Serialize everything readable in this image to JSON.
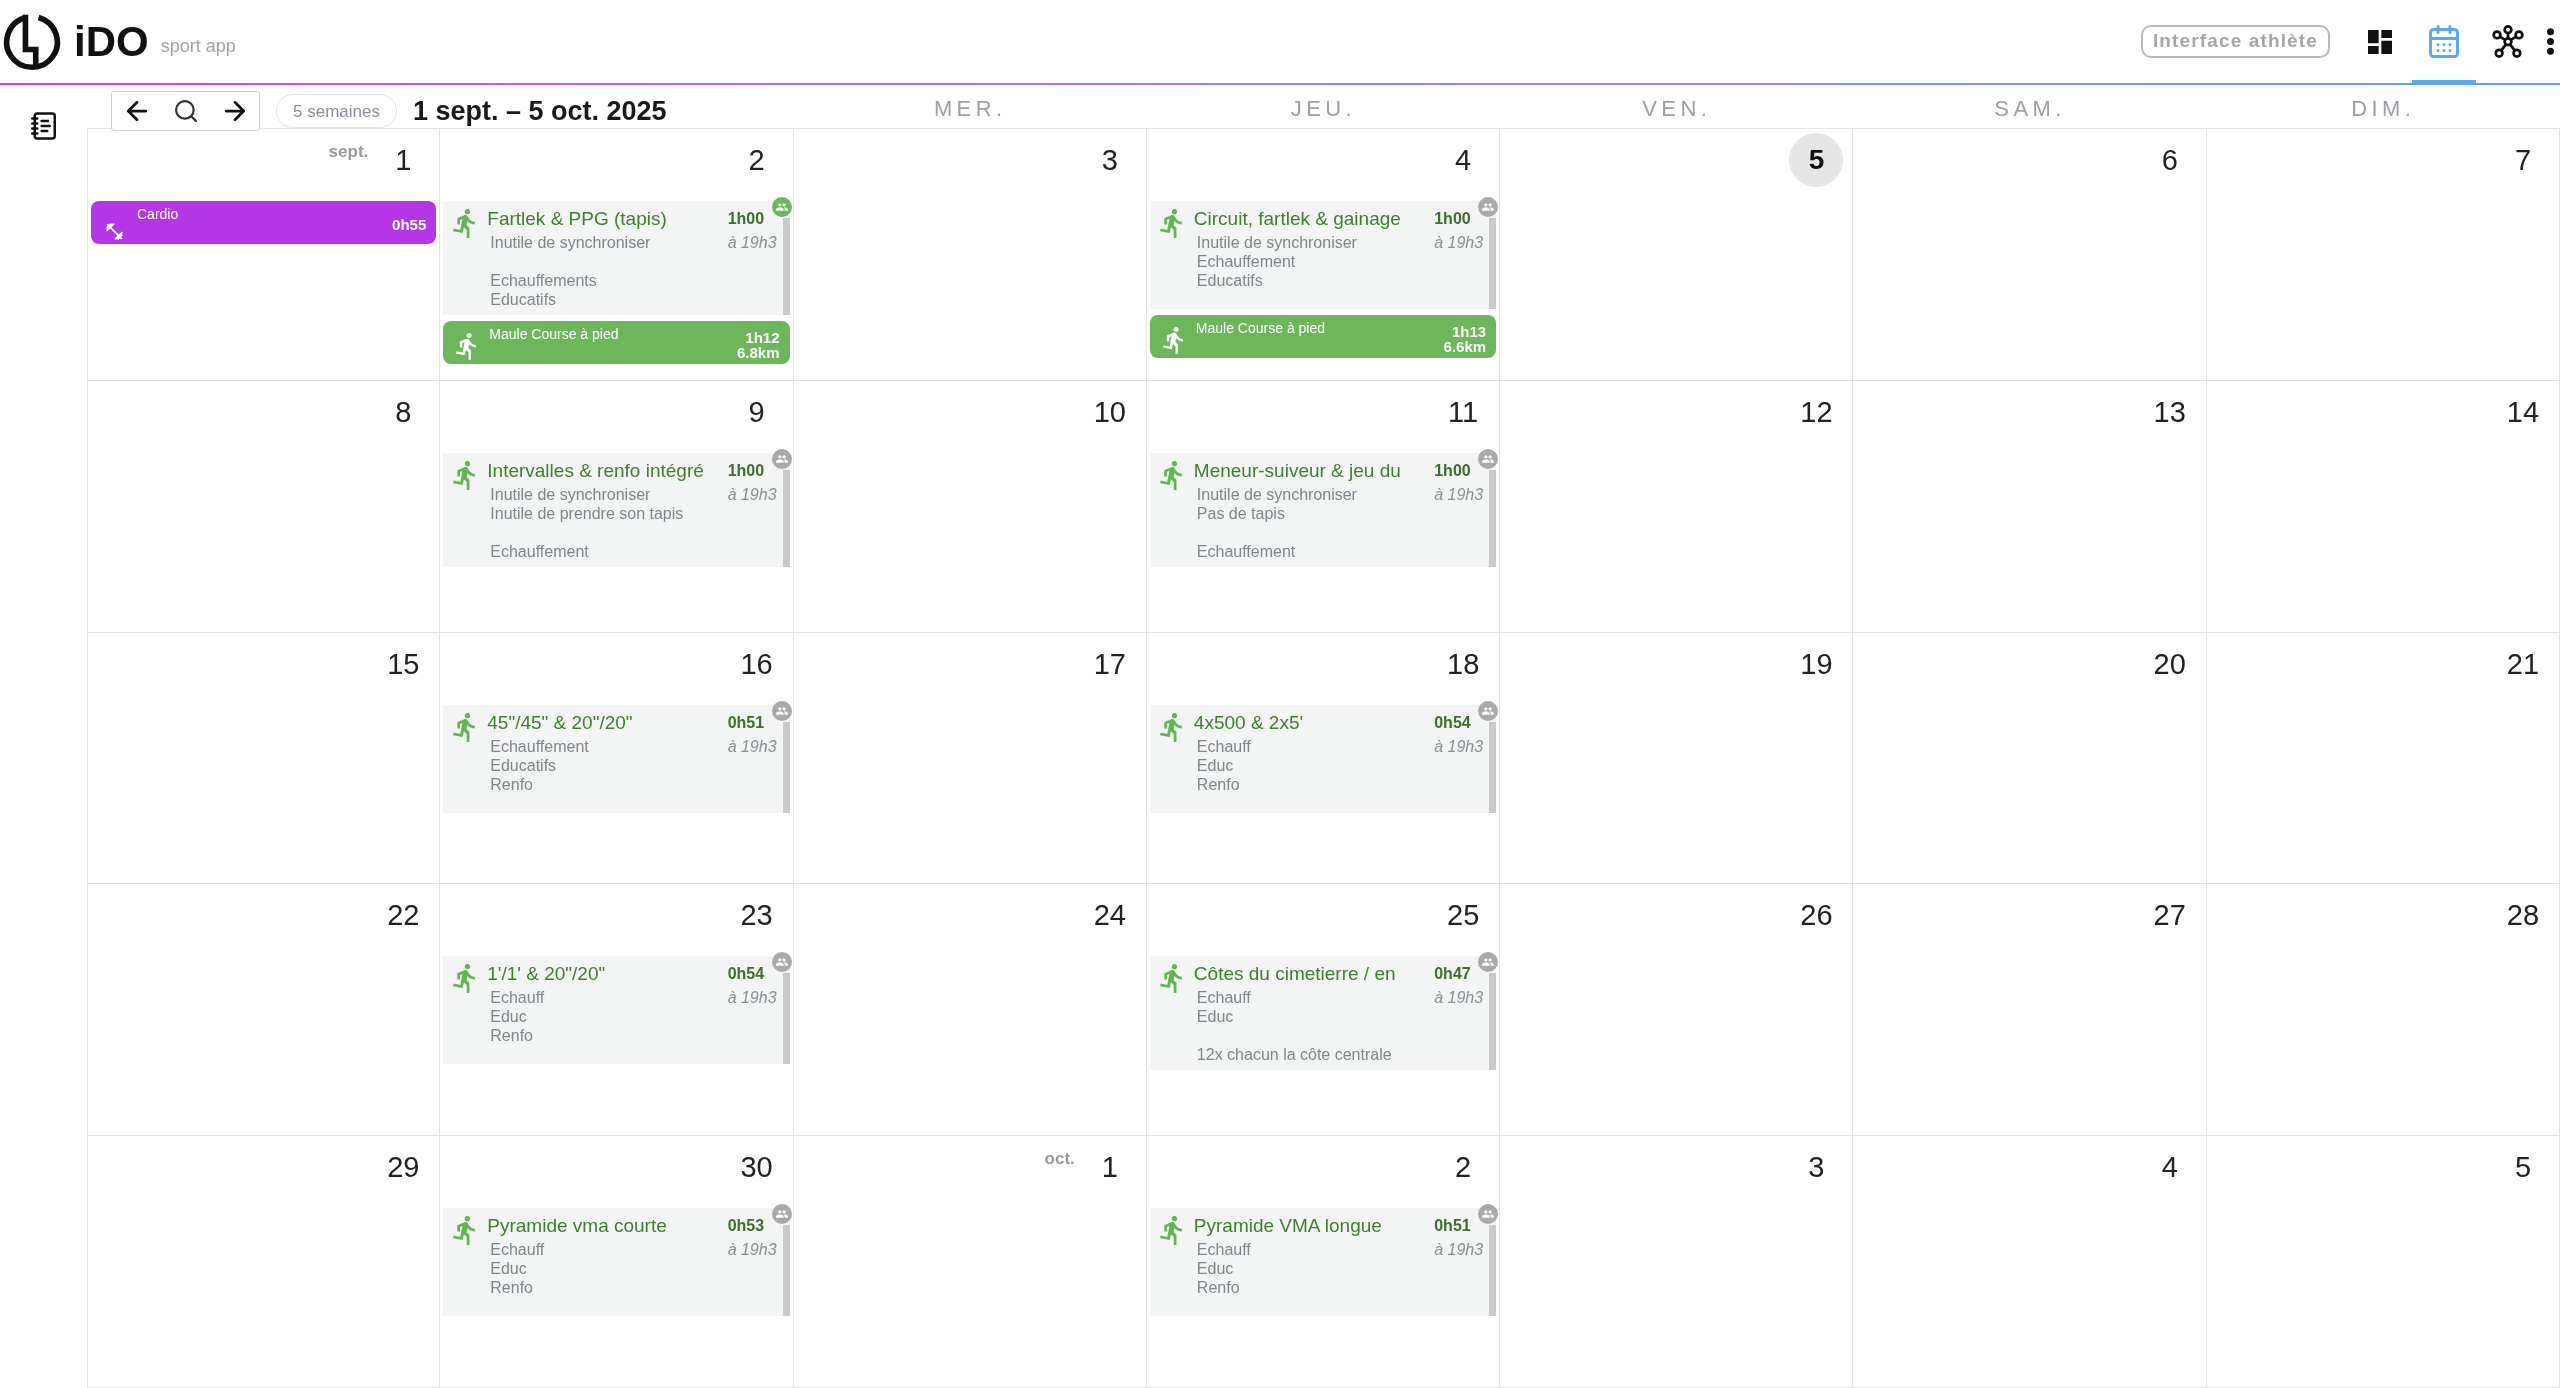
{
  "header": {
    "app_name": "iDO",
    "tagline": "sport app",
    "athlete_button": "Interface athlète",
    "nav": [
      {
        "kind": "dashboard",
        "selected": false
      },
      {
        "kind": "calendar",
        "selected": true
      },
      {
        "kind": "network",
        "selected": false
      },
      {
        "kind": "more",
        "selected": false
      }
    ]
  },
  "toolbar": {
    "range": "5 semaines",
    "title": "1 sept. – 5 oct. 2025"
  },
  "day_headers": [
    "MER.",
    "JEU.",
    "VEN.",
    "SAM.",
    "DIM."
  ],
  "weeks": [
    {
      "days": [
        {
          "number": "1",
          "month": "sept.",
          "today": false,
          "events": [
            {
              "kind": "strength",
              "title": "Cardio",
              "duration": "0h55"
            }
          ]
        },
        {
          "number": "2",
          "today": false,
          "events": [
            {
              "kind": "workout",
              "title": "Fartlek & PPG (tapis)",
              "duration": "1h00",
              "time": "à 19h3",
              "badge_active": true,
              "notes": [
                [
                  "Inutile de synchroniser"
                ],
                [
                  "Echauffements",
                  "Educatifs"
                ]
              ]
            },
            {
              "kind": "run",
              "title": "Maule Course à pied",
              "duration": "1h12",
              "distance": "6.8km"
            }
          ]
        },
        {
          "number": "3",
          "today": false
        },
        {
          "number": "4",
          "today": false,
          "events": [
            {
              "kind": "workout",
              "title": "Circuit, fartlek & gainage",
              "duration": "1h00",
              "time": "à 19h3",
              "badge_active": false,
              "notes": [
                [
                  "Inutile de synchroniser",
                  "Echauffement",
                  "Educatifs"
                ]
              ]
            },
            {
              "kind": "run",
              "title": "Maule Course à pied",
              "duration": "1h13",
              "distance": "6.6km"
            }
          ]
        },
        {
          "number": "5",
          "today": true
        },
        {
          "number": "6",
          "today": false
        },
        {
          "number": "7",
          "today": false
        }
      ]
    },
    {
      "days": [
        {
          "number": "8",
          "today": false
        },
        {
          "number": "9",
          "today": false,
          "events": [
            {
              "kind": "workout",
              "title": "Intervalles & renfo intégré",
              "duration": "1h00",
              "time": "à 19h3",
              "badge_active": false,
              "notes": [
                [
                  "Inutile de synchroniser",
                  "Inutile de prendre son tapis"
                ],
                [
                  "Echauffement"
                ]
              ]
            }
          ]
        },
        {
          "number": "10",
          "today": false
        },
        {
          "number": "11",
          "today": false,
          "events": [
            {
              "kind": "workout",
              "title": "Meneur-suiveur & jeu du",
              "duration": "1h00",
              "time": "à 19h3",
              "badge_active": false,
              "notes": [
                [
                  "Inutile de synchroniser",
                  "Pas de tapis"
                ],
                [
                  "Echauffement"
                ]
              ]
            }
          ]
        },
        {
          "number": "12",
          "today": false
        },
        {
          "number": "13",
          "today": false
        },
        {
          "number": "14",
          "today": false
        }
      ]
    },
    {
      "days": [
        {
          "number": "15",
          "today": false
        },
        {
          "number": "16",
          "today": false,
          "events": [
            {
              "kind": "workout",
              "title": "45\"/45\" & 20\"/20\"",
              "duration": "0h51",
              "time": "à 19h3",
              "badge_active": false,
              "notes": [
                [
                  "Echauffement",
                  "Educatifs",
                  "Renfo"
                ]
              ]
            }
          ]
        },
        {
          "number": "17",
          "today": false
        },
        {
          "number": "18",
          "today": false,
          "events": [
            {
              "kind": "workout",
              "title": "4x500 & 2x5'",
              "duration": "0h54",
              "time": "à 19h3",
              "badge_active": false,
              "notes": [
                [
                  "Echauff",
                  "Educ",
                  "Renfo"
                ]
              ]
            }
          ]
        },
        {
          "number": "19",
          "today": false
        },
        {
          "number": "20",
          "today": false
        },
        {
          "number": "21",
          "today": false
        }
      ]
    },
    {
      "days": [
        {
          "number": "22",
          "today": false
        },
        {
          "number": "23",
          "today": false,
          "events": [
            {
              "kind": "workout",
              "title": "1'/1' & 20\"/20\"",
              "duration": "0h54",
              "time": "à 19h3",
              "badge_active": false,
              "notes": [
                [
                  "Echauff",
                  "Educ",
                  "Renfo"
                ]
              ]
            }
          ]
        },
        {
          "number": "24",
          "today": false
        },
        {
          "number": "25",
          "today": false,
          "events": [
            {
              "kind": "workout",
              "title": "Côtes du cimetierre / en",
              "duration": "0h47",
              "time": "à 19h3",
              "badge_active": false,
              "notes": [
                [
                  "Echauff",
                  "Educ"
                ],
                [
                  "12x chacun la côte centrale"
                ]
              ]
            }
          ]
        },
        {
          "number": "26",
          "today": false
        },
        {
          "number": "27",
          "today": false
        },
        {
          "number": "28",
          "today": false
        }
      ]
    },
    {
      "days": [
        {
          "number": "29",
          "today": false
        },
        {
          "number": "30",
          "today": false,
          "events": [
            {
              "kind": "workout",
              "title": "Pyramide vma courte",
              "duration": "0h53",
              "time": "à 19h3",
              "badge_active": false,
              "notes": [
                [
                  "Echauff",
                  "Educ",
                  "Renfo"
                ]
              ]
            }
          ]
        },
        {
          "number": "1",
          "month": "oct.",
          "today": false
        },
        {
          "number": "2",
          "today": false,
          "events": [
            {
              "kind": "workout",
              "title": "Pyramide VMA longue",
              "duration": "0h51",
              "time": "à 19h3",
              "badge_active": false,
              "notes": [
                [
                  "Echauff",
                  "Educ",
                  "Renfo"
                ]
              ]
            }
          ]
        },
        {
          "number": "3",
          "today": false
        },
        {
          "number": "4",
          "today": false
        },
        {
          "number": "5",
          "today": false
        }
      ]
    }
  ]
}
